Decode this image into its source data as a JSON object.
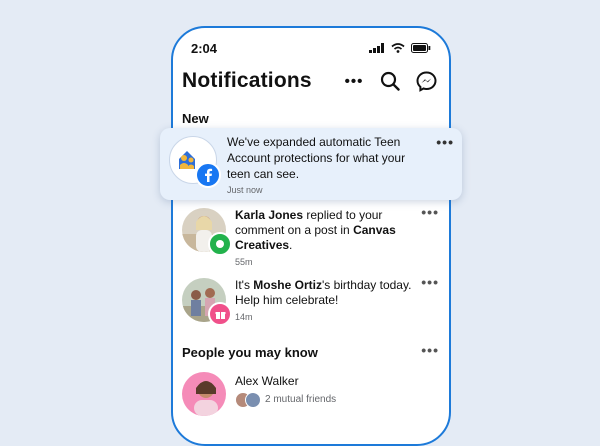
{
  "status_bar": {
    "time": "2:04"
  },
  "header": {
    "title": "Notifications",
    "more_label": "•••"
  },
  "sections": {
    "new_label": "New",
    "people_label": "People you may know"
  },
  "featured_notification": {
    "text": "We've expanded automatic Teen Account protections for what your teen can see.",
    "time": "Just now",
    "more_label": "•••"
  },
  "notifications": [
    {
      "name": "Karla Jones",
      "text_1": " replied to your comment on a post in ",
      "group": "Canvas Creatives",
      "text_2": ".",
      "time": "55m",
      "more_label": "•••"
    },
    {
      "prefix": "It's ",
      "name": "Moshe Ortiz",
      "text_1": "'s birthday today. Help him celebrate!",
      "time": "14m",
      "more_label": "•••"
    }
  ],
  "people": [
    {
      "name": "Alex Walker",
      "mutual": "2 mutual friends"
    }
  ],
  "colors": {
    "accent": "#1d7ad9",
    "background": "#e4ebf5",
    "card": "#e7f0fb",
    "comment_badge": "#22b24c",
    "birthday_badge": "#f0508a"
  }
}
